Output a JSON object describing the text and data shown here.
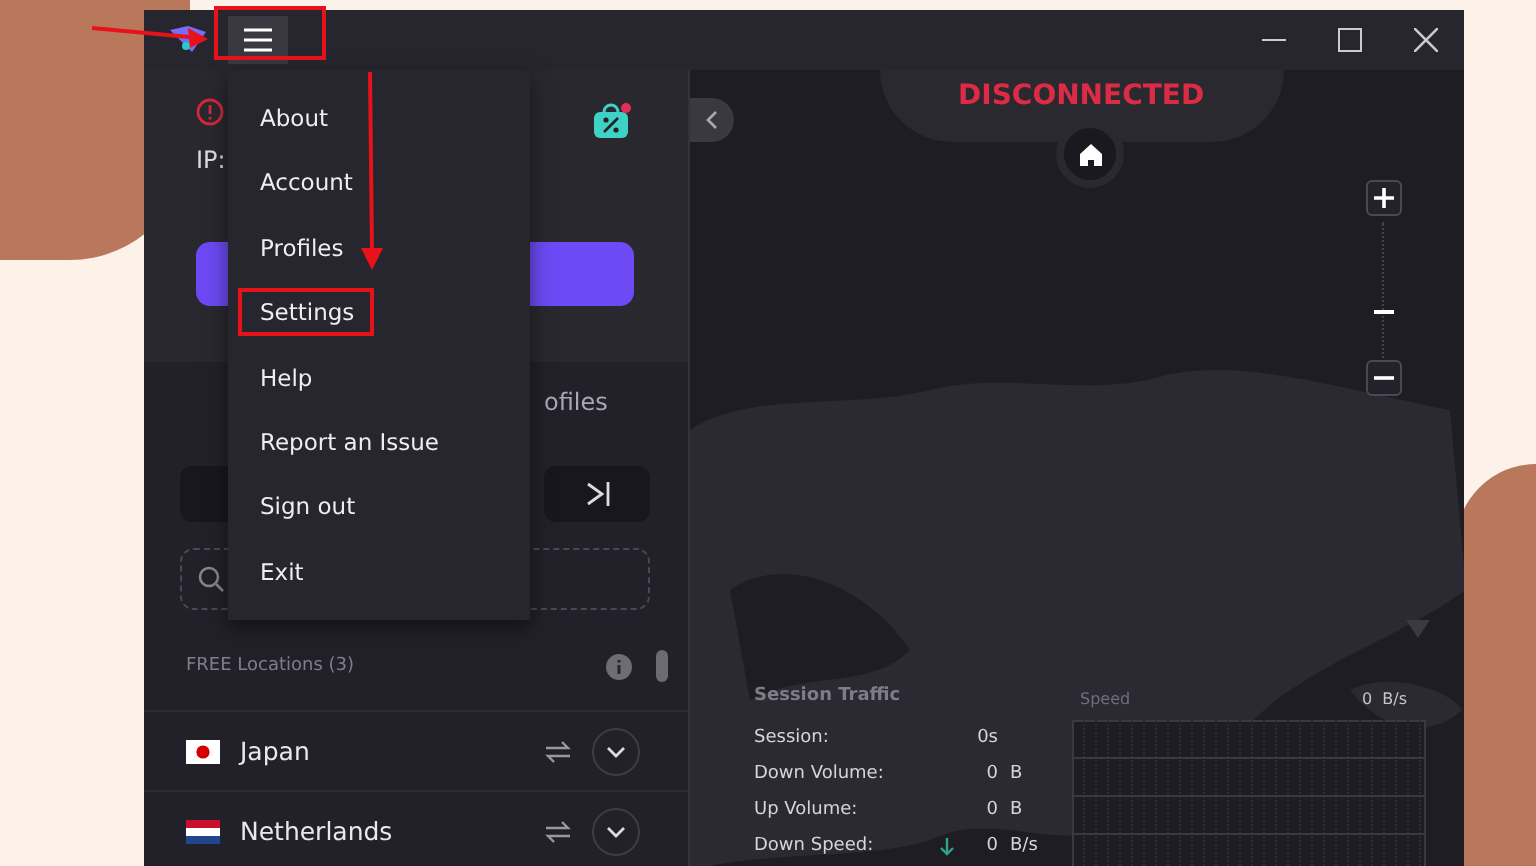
{
  "menu": {
    "items": [
      {
        "label": "About",
        "selected": false
      },
      {
        "label": "Account",
        "selected": false
      },
      {
        "label": "Profiles",
        "selected": false
      },
      {
        "label": "Settings",
        "selected": true
      },
      {
        "label": "Help",
        "selected": false
      },
      {
        "label": "Report an Issue",
        "selected": false
      },
      {
        "label": "Sign out",
        "selected": false
      },
      {
        "label": "Exit",
        "selected": false
      }
    ]
  },
  "status": {
    "ip_label": "IP:"
  },
  "tabs": [
    {
      "label": "ofiles",
      "selected": false
    }
  ],
  "locations": {
    "heading": "FREE Locations (3)",
    "items": [
      {
        "name": "Japan",
        "kind": "jp"
      },
      {
        "name": "Netherlands",
        "kind": "nl"
      }
    ]
  },
  "map": {
    "status": "DISCONNECTED",
    "zoom": {
      "level": 0.34
    }
  },
  "traffic": {
    "title": "Session Traffic",
    "rows": [
      {
        "label": "Session:",
        "value": "0s",
        "unit": ""
      },
      {
        "label": "Down Volume:",
        "value": "0",
        "unit": "B"
      },
      {
        "label": "Up Volume:",
        "value": "0",
        "unit": "B"
      },
      {
        "label": "Down Speed:",
        "value": "0",
        "unit": "B/s",
        "kind": "down"
      }
    ],
    "speed_label": "Speed",
    "speed_value": "0  B/s"
  }
}
